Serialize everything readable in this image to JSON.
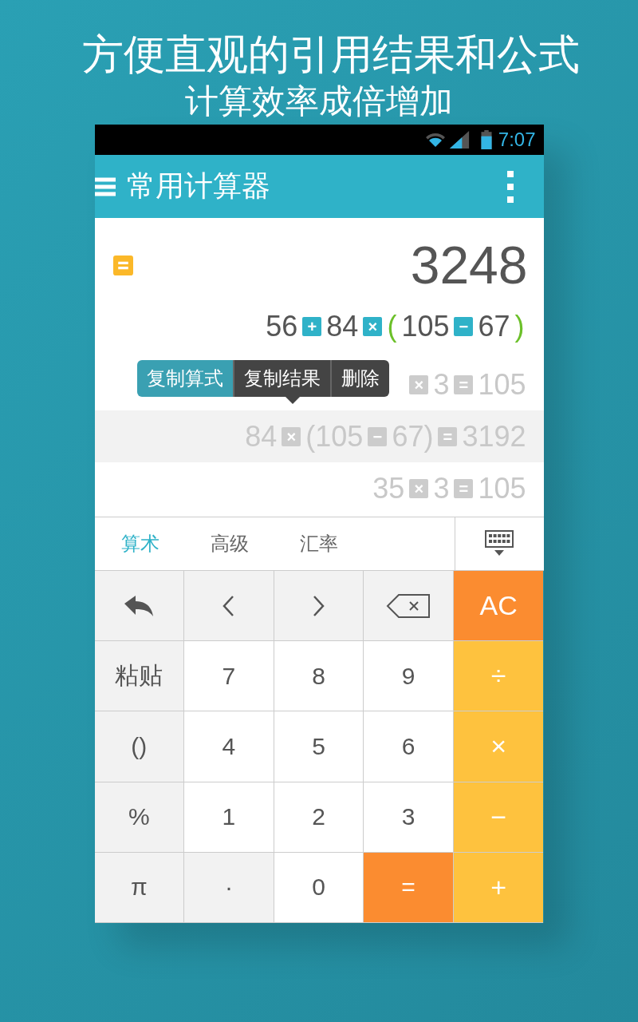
{
  "headline": [
    "方便直观的引用结果和公式",
    "计算效率成倍增加"
  ],
  "status_bar": {
    "time": "7:07"
  },
  "app_bar": {
    "title": "常用计算器"
  },
  "display": {
    "result": "3248",
    "expression": [
      {
        "kind": "num",
        "text": "56"
      },
      {
        "kind": "op",
        "text": "+"
      },
      {
        "kind": "num",
        "text": "84"
      },
      {
        "kind": "op",
        "text": "×"
      },
      {
        "kind": "paren",
        "text": "("
      },
      {
        "kind": "num",
        "text": "105"
      },
      {
        "kind": "op",
        "text": "−"
      },
      {
        "kind": "num",
        "text": "67"
      },
      {
        "kind": "paren",
        "text": ")"
      }
    ]
  },
  "history": [
    {
      "selected": false,
      "tokens": [
        {
          "kind": "op",
          "text": "×"
        },
        {
          "kind": "num",
          "text": "3"
        },
        {
          "kind": "op",
          "text": "="
        },
        {
          "kind": "num",
          "text": "105"
        }
      ]
    },
    {
      "selected": true,
      "tokens": [
        {
          "kind": "num",
          "text": "84"
        },
        {
          "kind": "op",
          "text": "×"
        },
        {
          "kind": "num",
          "text": "(105"
        },
        {
          "kind": "op",
          "text": "−"
        },
        {
          "kind": "num",
          "text": "67)"
        },
        {
          "kind": "op",
          "text": "="
        },
        {
          "kind": "num",
          "text": "3192"
        }
      ]
    },
    {
      "selected": false,
      "tokens": [
        {
          "kind": "num",
          "text": "35"
        },
        {
          "kind": "op",
          "text": "×"
        },
        {
          "kind": "num",
          "text": "3"
        },
        {
          "kind": "op",
          "text": "="
        },
        {
          "kind": "num",
          "text": "105"
        }
      ]
    }
  ],
  "context_menu": [
    {
      "label": "复制算式",
      "selected": true
    },
    {
      "label": "复制结果",
      "selected": false
    },
    {
      "label": "删除",
      "selected": false
    }
  ],
  "tabs": [
    {
      "label": "算术",
      "selected": true
    },
    {
      "label": "高级",
      "selected": false
    },
    {
      "label": "汇率",
      "selected": false
    }
  ],
  "keys": [
    {
      "kind": "icon",
      "color": "#f2f2f2"
    },
    {
      "kind": "icon",
      "color": "#f2f2f2"
    },
    {
      "kind": "icon",
      "color": "#f2f2f2"
    },
    {
      "kind": "icon",
      "color": "#f2f2f2"
    },
    {
      "kind": "text",
      "label": "AC",
      "color": "#fb8c30"
    },
    {
      "kind": "text",
      "label": "粘贴",
      "color": "#f2f2f2"
    },
    {
      "kind": "text",
      "label": "7",
      "color": "#ffffff"
    },
    {
      "kind": "text",
      "label": "8",
      "color": "#ffffff"
    },
    {
      "kind": "text",
      "label": "9",
      "color": "#ffffff"
    },
    {
      "kind": "text",
      "label": "÷",
      "color": "#fec23e"
    },
    {
      "kind": "text",
      "label": "()",
      "color": "#f2f2f2"
    },
    {
      "kind": "text",
      "label": "4",
      "color": "#ffffff"
    },
    {
      "kind": "text",
      "label": "5",
      "color": "#ffffff"
    },
    {
      "kind": "text",
      "label": "6",
      "color": "#ffffff"
    },
    {
      "kind": "text",
      "label": "×",
      "color": "#fec23e"
    },
    {
      "kind": "text",
      "label": "%",
      "color": "#f2f2f2"
    },
    {
      "kind": "text",
      "label": "1",
      "color": "#ffffff"
    },
    {
      "kind": "text",
      "label": "2",
      "color": "#ffffff"
    },
    {
      "kind": "text",
      "label": "3",
      "color": "#ffffff"
    },
    {
      "kind": "text",
      "label": "−",
      "color": "#fec23e"
    },
    {
      "kind": "text",
      "label": "π",
      "color": "#f2f2f2"
    },
    {
      "kind": "text",
      "label": "·",
      "color": "#f2f2f2"
    },
    {
      "kind": "text",
      "label": "0",
      "color": "#ffffff"
    },
    {
      "kind": "text",
      "label": "=",
      "color": "#fb8c30"
    },
    {
      "kind": "text",
      "label": "+",
      "color": "#fec23e"
    }
  ]
}
